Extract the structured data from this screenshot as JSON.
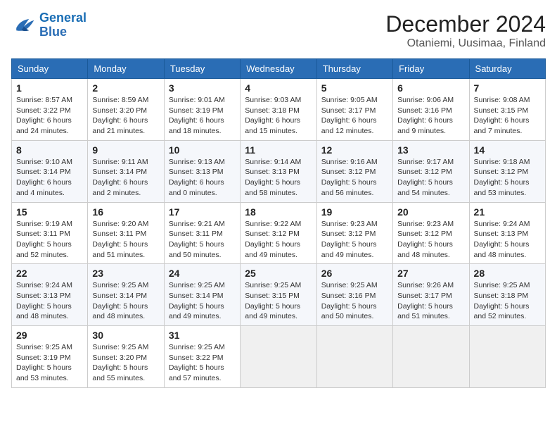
{
  "logo": {
    "text_general": "General",
    "text_blue": "Blue"
  },
  "header": {
    "month": "December 2024",
    "location": "Otaniemi, Uusimaa, Finland"
  },
  "weekdays": [
    "Sunday",
    "Monday",
    "Tuesday",
    "Wednesday",
    "Thursday",
    "Friday",
    "Saturday"
  ],
  "weeks": [
    [
      {
        "day": "1",
        "sunrise": "Sunrise: 8:57 AM",
        "sunset": "Sunset: 3:22 PM",
        "daylight": "Daylight: 6 hours and 24 minutes."
      },
      {
        "day": "2",
        "sunrise": "Sunrise: 8:59 AM",
        "sunset": "Sunset: 3:20 PM",
        "daylight": "Daylight: 6 hours and 21 minutes."
      },
      {
        "day": "3",
        "sunrise": "Sunrise: 9:01 AM",
        "sunset": "Sunset: 3:19 PM",
        "daylight": "Daylight: 6 hours and 18 minutes."
      },
      {
        "day": "4",
        "sunrise": "Sunrise: 9:03 AM",
        "sunset": "Sunset: 3:18 PM",
        "daylight": "Daylight: 6 hours and 15 minutes."
      },
      {
        "day": "5",
        "sunrise": "Sunrise: 9:05 AM",
        "sunset": "Sunset: 3:17 PM",
        "daylight": "Daylight: 6 hours and 12 minutes."
      },
      {
        "day": "6",
        "sunrise": "Sunrise: 9:06 AM",
        "sunset": "Sunset: 3:16 PM",
        "daylight": "Daylight: 6 hours and 9 minutes."
      },
      {
        "day": "7",
        "sunrise": "Sunrise: 9:08 AM",
        "sunset": "Sunset: 3:15 PM",
        "daylight": "Daylight: 6 hours and 7 minutes."
      }
    ],
    [
      {
        "day": "8",
        "sunrise": "Sunrise: 9:10 AM",
        "sunset": "Sunset: 3:14 PM",
        "daylight": "Daylight: 6 hours and 4 minutes."
      },
      {
        "day": "9",
        "sunrise": "Sunrise: 9:11 AM",
        "sunset": "Sunset: 3:14 PM",
        "daylight": "Daylight: 6 hours and 2 minutes."
      },
      {
        "day": "10",
        "sunrise": "Sunrise: 9:13 AM",
        "sunset": "Sunset: 3:13 PM",
        "daylight": "Daylight: 6 hours and 0 minutes."
      },
      {
        "day": "11",
        "sunrise": "Sunrise: 9:14 AM",
        "sunset": "Sunset: 3:13 PM",
        "daylight": "Daylight: 5 hours and 58 minutes."
      },
      {
        "day": "12",
        "sunrise": "Sunrise: 9:16 AM",
        "sunset": "Sunset: 3:12 PM",
        "daylight": "Daylight: 5 hours and 56 minutes."
      },
      {
        "day": "13",
        "sunrise": "Sunrise: 9:17 AM",
        "sunset": "Sunset: 3:12 PM",
        "daylight": "Daylight: 5 hours and 54 minutes."
      },
      {
        "day": "14",
        "sunrise": "Sunrise: 9:18 AM",
        "sunset": "Sunset: 3:12 PM",
        "daylight": "Daylight: 5 hours and 53 minutes."
      }
    ],
    [
      {
        "day": "15",
        "sunrise": "Sunrise: 9:19 AM",
        "sunset": "Sunset: 3:11 PM",
        "daylight": "Daylight: 5 hours and 52 minutes."
      },
      {
        "day": "16",
        "sunrise": "Sunrise: 9:20 AM",
        "sunset": "Sunset: 3:11 PM",
        "daylight": "Daylight: 5 hours and 51 minutes."
      },
      {
        "day": "17",
        "sunrise": "Sunrise: 9:21 AM",
        "sunset": "Sunset: 3:11 PM",
        "daylight": "Daylight: 5 hours and 50 minutes."
      },
      {
        "day": "18",
        "sunrise": "Sunrise: 9:22 AM",
        "sunset": "Sunset: 3:12 PM",
        "daylight": "Daylight: 5 hours and 49 minutes."
      },
      {
        "day": "19",
        "sunrise": "Sunrise: 9:23 AM",
        "sunset": "Sunset: 3:12 PM",
        "daylight": "Daylight: 5 hours and 49 minutes."
      },
      {
        "day": "20",
        "sunrise": "Sunrise: 9:23 AM",
        "sunset": "Sunset: 3:12 PM",
        "daylight": "Daylight: 5 hours and 48 minutes."
      },
      {
        "day": "21",
        "sunrise": "Sunrise: 9:24 AM",
        "sunset": "Sunset: 3:13 PM",
        "daylight": "Daylight: 5 hours and 48 minutes."
      }
    ],
    [
      {
        "day": "22",
        "sunrise": "Sunrise: 9:24 AM",
        "sunset": "Sunset: 3:13 PM",
        "daylight": "Daylight: 5 hours and 48 minutes."
      },
      {
        "day": "23",
        "sunrise": "Sunrise: 9:25 AM",
        "sunset": "Sunset: 3:14 PM",
        "daylight": "Daylight: 5 hours and 48 minutes."
      },
      {
        "day": "24",
        "sunrise": "Sunrise: 9:25 AM",
        "sunset": "Sunset: 3:14 PM",
        "daylight": "Daylight: 5 hours and 49 minutes."
      },
      {
        "day": "25",
        "sunrise": "Sunrise: 9:25 AM",
        "sunset": "Sunset: 3:15 PM",
        "daylight": "Daylight: 5 hours and 49 minutes."
      },
      {
        "day": "26",
        "sunrise": "Sunrise: 9:25 AM",
        "sunset": "Sunset: 3:16 PM",
        "daylight": "Daylight: 5 hours and 50 minutes."
      },
      {
        "day": "27",
        "sunrise": "Sunrise: 9:26 AM",
        "sunset": "Sunset: 3:17 PM",
        "daylight": "Daylight: 5 hours and 51 minutes."
      },
      {
        "day": "28",
        "sunrise": "Sunrise: 9:25 AM",
        "sunset": "Sunset: 3:18 PM",
        "daylight": "Daylight: 5 hours and 52 minutes."
      }
    ],
    [
      {
        "day": "29",
        "sunrise": "Sunrise: 9:25 AM",
        "sunset": "Sunset: 3:19 PM",
        "daylight": "Daylight: 5 hours and 53 minutes."
      },
      {
        "day": "30",
        "sunrise": "Sunrise: 9:25 AM",
        "sunset": "Sunset: 3:20 PM",
        "daylight": "Daylight: 5 hours and 55 minutes."
      },
      {
        "day": "31",
        "sunrise": "Sunrise: 9:25 AM",
        "sunset": "Sunset: 3:22 PM",
        "daylight": "Daylight: 5 hours and 57 minutes."
      },
      null,
      null,
      null,
      null
    ]
  ]
}
